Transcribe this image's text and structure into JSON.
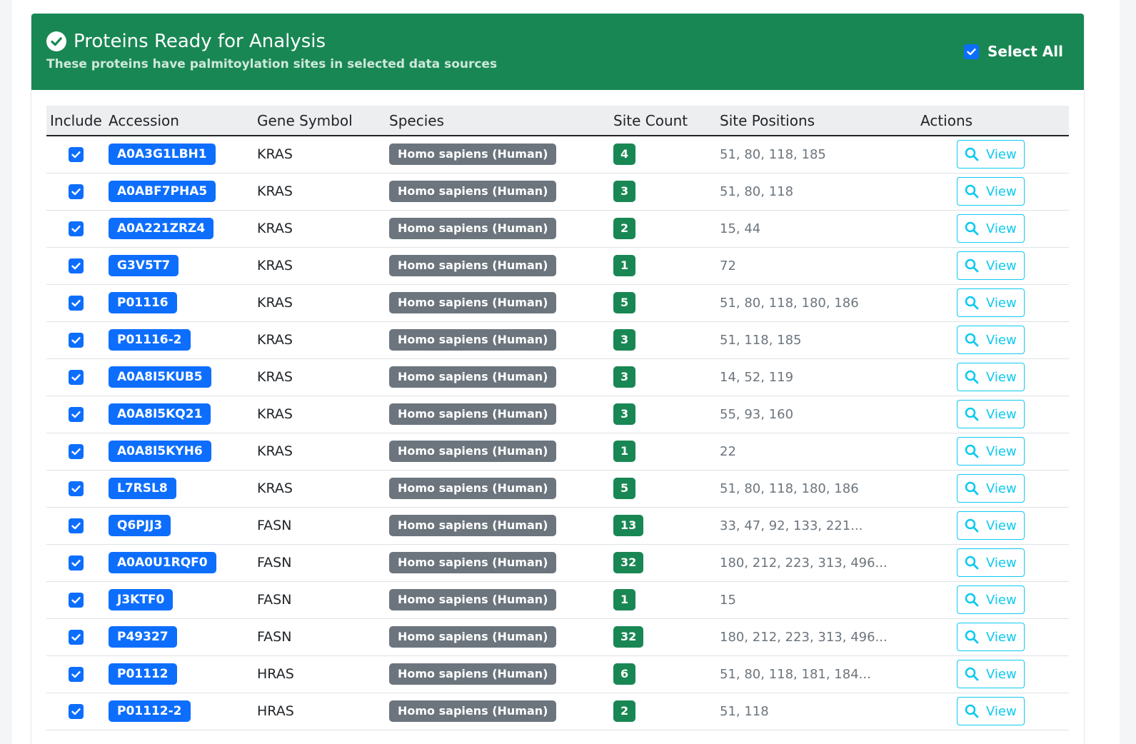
{
  "header": {
    "title": "Proteins Ready for Analysis",
    "subtitle": "These proteins have palmitoylation sites in selected data sources",
    "select_all_label": "Select All",
    "select_all_checked": true,
    "title_icon": "check-circle-icon"
  },
  "colors": {
    "header_bg": "#198754",
    "accession_badge": "#0d6efd",
    "species_badge": "#6c757d",
    "count_badge": "#198754",
    "view_button": "#0dcaf0"
  },
  "table": {
    "columns": [
      "Include",
      "Accession",
      "Gene Symbol",
      "Species",
      "Site Count",
      "Site Positions",
      "Actions"
    ],
    "view_label": "View",
    "view_icon": "search-icon",
    "rows": [
      {
        "accession": "A0A3G1LBH1",
        "gene": "KRAS",
        "species": "Homo sapiens (Human)",
        "count": "4",
        "positions": "51, 80, 118, 185"
      },
      {
        "accession": "A0ABF7PHA5",
        "gene": "KRAS",
        "species": "Homo sapiens (Human)",
        "count": "3",
        "positions": "51, 80, 118"
      },
      {
        "accession": "A0A221ZRZ4",
        "gene": "KRAS",
        "species": "Homo sapiens (Human)",
        "count": "2",
        "positions": "15, 44"
      },
      {
        "accession": "G3V5T7",
        "gene": "KRAS",
        "species": "Homo sapiens (Human)",
        "count": "1",
        "positions": "72"
      },
      {
        "accession": "P01116",
        "gene": "KRAS",
        "species": "Homo sapiens (Human)",
        "count": "5",
        "positions": "51, 80, 118, 180, 186"
      },
      {
        "accession": "P01116-2",
        "gene": "KRAS",
        "species": "Homo sapiens (Human)",
        "count": "3",
        "positions": "51, 118, 185"
      },
      {
        "accession": "A0A8I5KUB5",
        "gene": "KRAS",
        "species": "Homo sapiens (Human)",
        "count": "3",
        "positions": "14, 52, 119"
      },
      {
        "accession": "A0A8I5KQ21",
        "gene": "KRAS",
        "species": "Homo sapiens (Human)",
        "count": "3",
        "positions": "55, 93, 160"
      },
      {
        "accession": "A0A8I5KYH6",
        "gene": "KRAS",
        "species": "Homo sapiens (Human)",
        "count": "1",
        "positions": "22"
      },
      {
        "accession": "L7RSL8",
        "gene": "KRAS",
        "species": "Homo sapiens (Human)",
        "count": "5",
        "positions": "51, 80, 118, 180, 186"
      },
      {
        "accession": "Q6PJJ3",
        "gene": "FASN",
        "species": "Homo sapiens (Human)",
        "count": "13",
        "positions": "33, 47, 92, 133, 221..."
      },
      {
        "accession": "A0A0U1RQF0",
        "gene": "FASN",
        "species": "Homo sapiens (Human)",
        "count": "32",
        "positions": "180, 212, 223, 313, 496..."
      },
      {
        "accession": "J3KTF0",
        "gene": "FASN",
        "species": "Homo sapiens (Human)",
        "count": "1",
        "positions": "15"
      },
      {
        "accession": "P49327",
        "gene": "FASN",
        "species": "Homo sapiens (Human)",
        "count": "32",
        "positions": "180, 212, 223, 313, 496..."
      },
      {
        "accession": "P01112",
        "gene": "HRAS",
        "species": "Homo sapiens (Human)",
        "count": "6",
        "positions": "51, 80, 118, 181, 184..."
      },
      {
        "accession": "P01112-2",
        "gene": "HRAS",
        "species": "Homo sapiens (Human)",
        "count": "2",
        "positions": "51, 118"
      }
    ]
  }
}
